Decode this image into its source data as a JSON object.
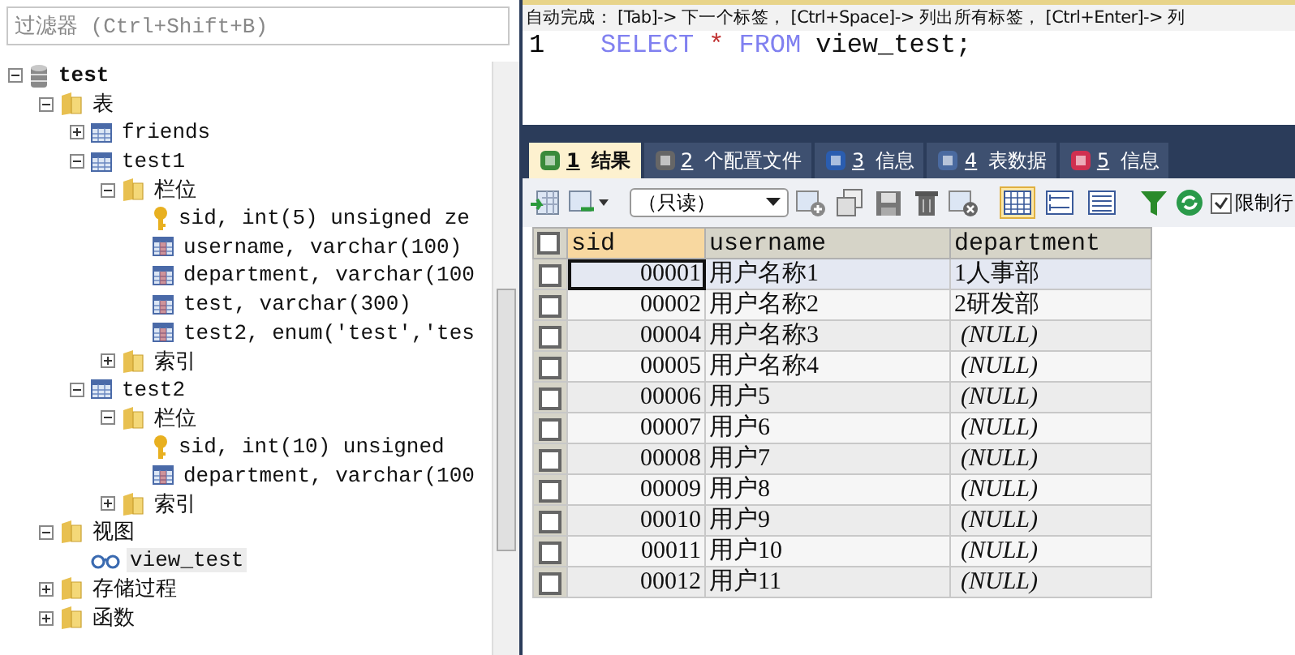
{
  "filter": {
    "placeholder": "过滤器 (Ctrl+Shift+B)"
  },
  "tree": [
    {
      "label": "test",
      "kind": "database",
      "expanded": true,
      "selected": false,
      "children": [
        {
          "label": "表",
          "kind": "folder",
          "expanded": true,
          "selected": false,
          "children": [
            {
              "label": "friends",
              "kind": "table",
              "expanded": false,
              "selected": false
            },
            {
              "label": "test1",
              "kind": "table",
              "expanded": true,
              "selected": false,
              "children": [
                {
                  "label": "栏位",
                  "kind": "folder",
                  "expanded": true,
                  "selected": false,
                  "children": [
                    {
                      "label": "sid, int(5) unsigned ze",
                      "kind": "key",
                      "selected": false
                    },
                    {
                      "label": "username, varchar(100)",
                      "kind": "column",
                      "selected": false
                    },
                    {
                      "label": "department, varchar(100",
                      "kind": "column",
                      "selected": false
                    },
                    {
                      "label": "test, varchar(300)",
                      "kind": "column",
                      "selected": false
                    },
                    {
                      "label": "test2, enum('test','tes",
                      "kind": "column",
                      "selected": false
                    }
                  ]
                },
                {
                  "label": "索引",
                  "kind": "folder",
                  "expanded": false,
                  "selected": false
                }
              ]
            },
            {
              "label": "test2",
              "kind": "table",
              "expanded": true,
              "selected": false,
              "children": [
                {
                  "label": "栏位",
                  "kind": "folder",
                  "expanded": true,
                  "selected": false,
                  "children": [
                    {
                      "label": "sid, int(10) unsigned",
                      "kind": "key",
                      "selected": false
                    },
                    {
                      "label": "department, varchar(100",
                      "kind": "column",
                      "selected": false
                    }
                  ]
                },
                {
                  "label": "索引",
                  "kind": "folder",
                  "expanded": false,
                  "selected": false
                }
              ]
            }
          ]
        },
        {
          "label": "视图",
          "kind": "folder",
          "expanded": true,
          "selected": false,
          "children": [
            {
              "label": "view_test",
              "kind": "view",
              "selected": true
            }
          ]
        },
        {
          "label": "存储过程",
          "kind": "folder",
          "expanded": false,
          "selected": false
        },
        {
          "label": "函数",
          "kind": "folder",
          "expanded": false,
          "selected": false
        }
      ]
    }
  ],
  "autocomplete_hint": "自动完成： [Tab]-> 下一个标签， [Ctrl+Space]-> 列出所有标签， [Ctrl+Enter]-> 列",
  "editor": {
    "line_number": "1",
    "tokens": [
      {
        "text": "SELECT",
        "kind": "keyword"
      },
      {
        "text": "*",
        "kind": "operator"
      },
      {
        "text": "FROM",
        "kind": "keyword"
      },
      {
        "text": "view_test;",
        "kind": "identifier"
      }
    ]
  },
  "tabs": [
    {
      "number": "1",
      "label": "结果",
      "kind": "result",
      "selected": true
    },
    {
      "number": "2",
      "label": "个配置文件",
      "kind": "profile",
      "selected": false
    },
    {
      "number": "3",
      "label": "信息",
      "kind": "info",
      "selected": false
    },
    {
      "number": "4",
      "label": "表数据",
      "kind": "tabledata",
      "selected": false
    },
    {
      "number": "5",
      "label": "信息",
      "kind": "info2",
      "selected": false
    }
  ],
  "toolbar": {
    "mode": "（只读）",
    "view_modes": [
      {
        "kind": "grid",
        "selected": true
      },
      {
        "kind": "form",
        "selected": false
      },
      {
        "kind": "text",
        "selected": false
      }
    ],
    "limit_rows": {
      "label": "限制行",
      "checked": true
    }
  },
  "grid": {
    "select_all_checked": false,
    "columns": [
      {
        "label": "sid",
        "selected": true
      },
      {
        "label": "username",
        "selected": false
      },
      {
        "label": "department",
        "selected": false
      }
    ],
    "rows": [
      {
        "sid": "00001",
        "username": "用户名称1",
        "department": "1人事部",
        "department_null": false,
        "checked": false,
        "selected": true
      },
      {
        "sid": "00002",
        "username": "用户名称2",
        "department": "2研发部",
        "department_null": false,
        "checked": false,
        "selected": false
      },
      {
        "sid": "00004",
        "username": "用户名称3",
        "department": "(NULL)",
        "department_null": true,
        "checked": false,
        "selected": false
      },
      {
        "sid": "00005",
        "username": "用户名称4",
        "department": "(NULL)",
        "department_null": true,
        "checked": false,
        "selected": false
      },
      {
        "sid": "00006",
        "username": "用户5",
        "department": "(NULL)",
        "department_null": true,
        "checked": false,
        "selected": false
      },
      {
        "sid": "00007",
        "username": "用户6",
        "department": "(NULL)",
        "department_null": true,
        "checked": false,
        "selected": false
      },
      {
        "sid": "00008",
        "username": "用户7",
        "department": "(NULL)",
        "department_null": true,
        "checked": false,
        "selected": false
      },
      {
        "sid": "00009",
        "username": "用户8",
        "department": "(NULL)",
        "department_null": true,
        "checked": false,
        "selected": false
      },
      {
        "sid": "00010",
        "username": "用户9",
        "department": "(NULL)",
        "department_null": true,
        "checked": false,
        "selected": false
      },
      {
        "sid": "00011",
        "username": "用户10",
        "department": "(NULL)",
        "department_null": true,
        "checked": false,
        "selected": false
      },
      {
        "sid": "00012",
        "username": "用户11",
        "department": "(NULL)",
        "department_null": true,
        "checked": false,
        "selected": false
      }
    ]
  }
}
